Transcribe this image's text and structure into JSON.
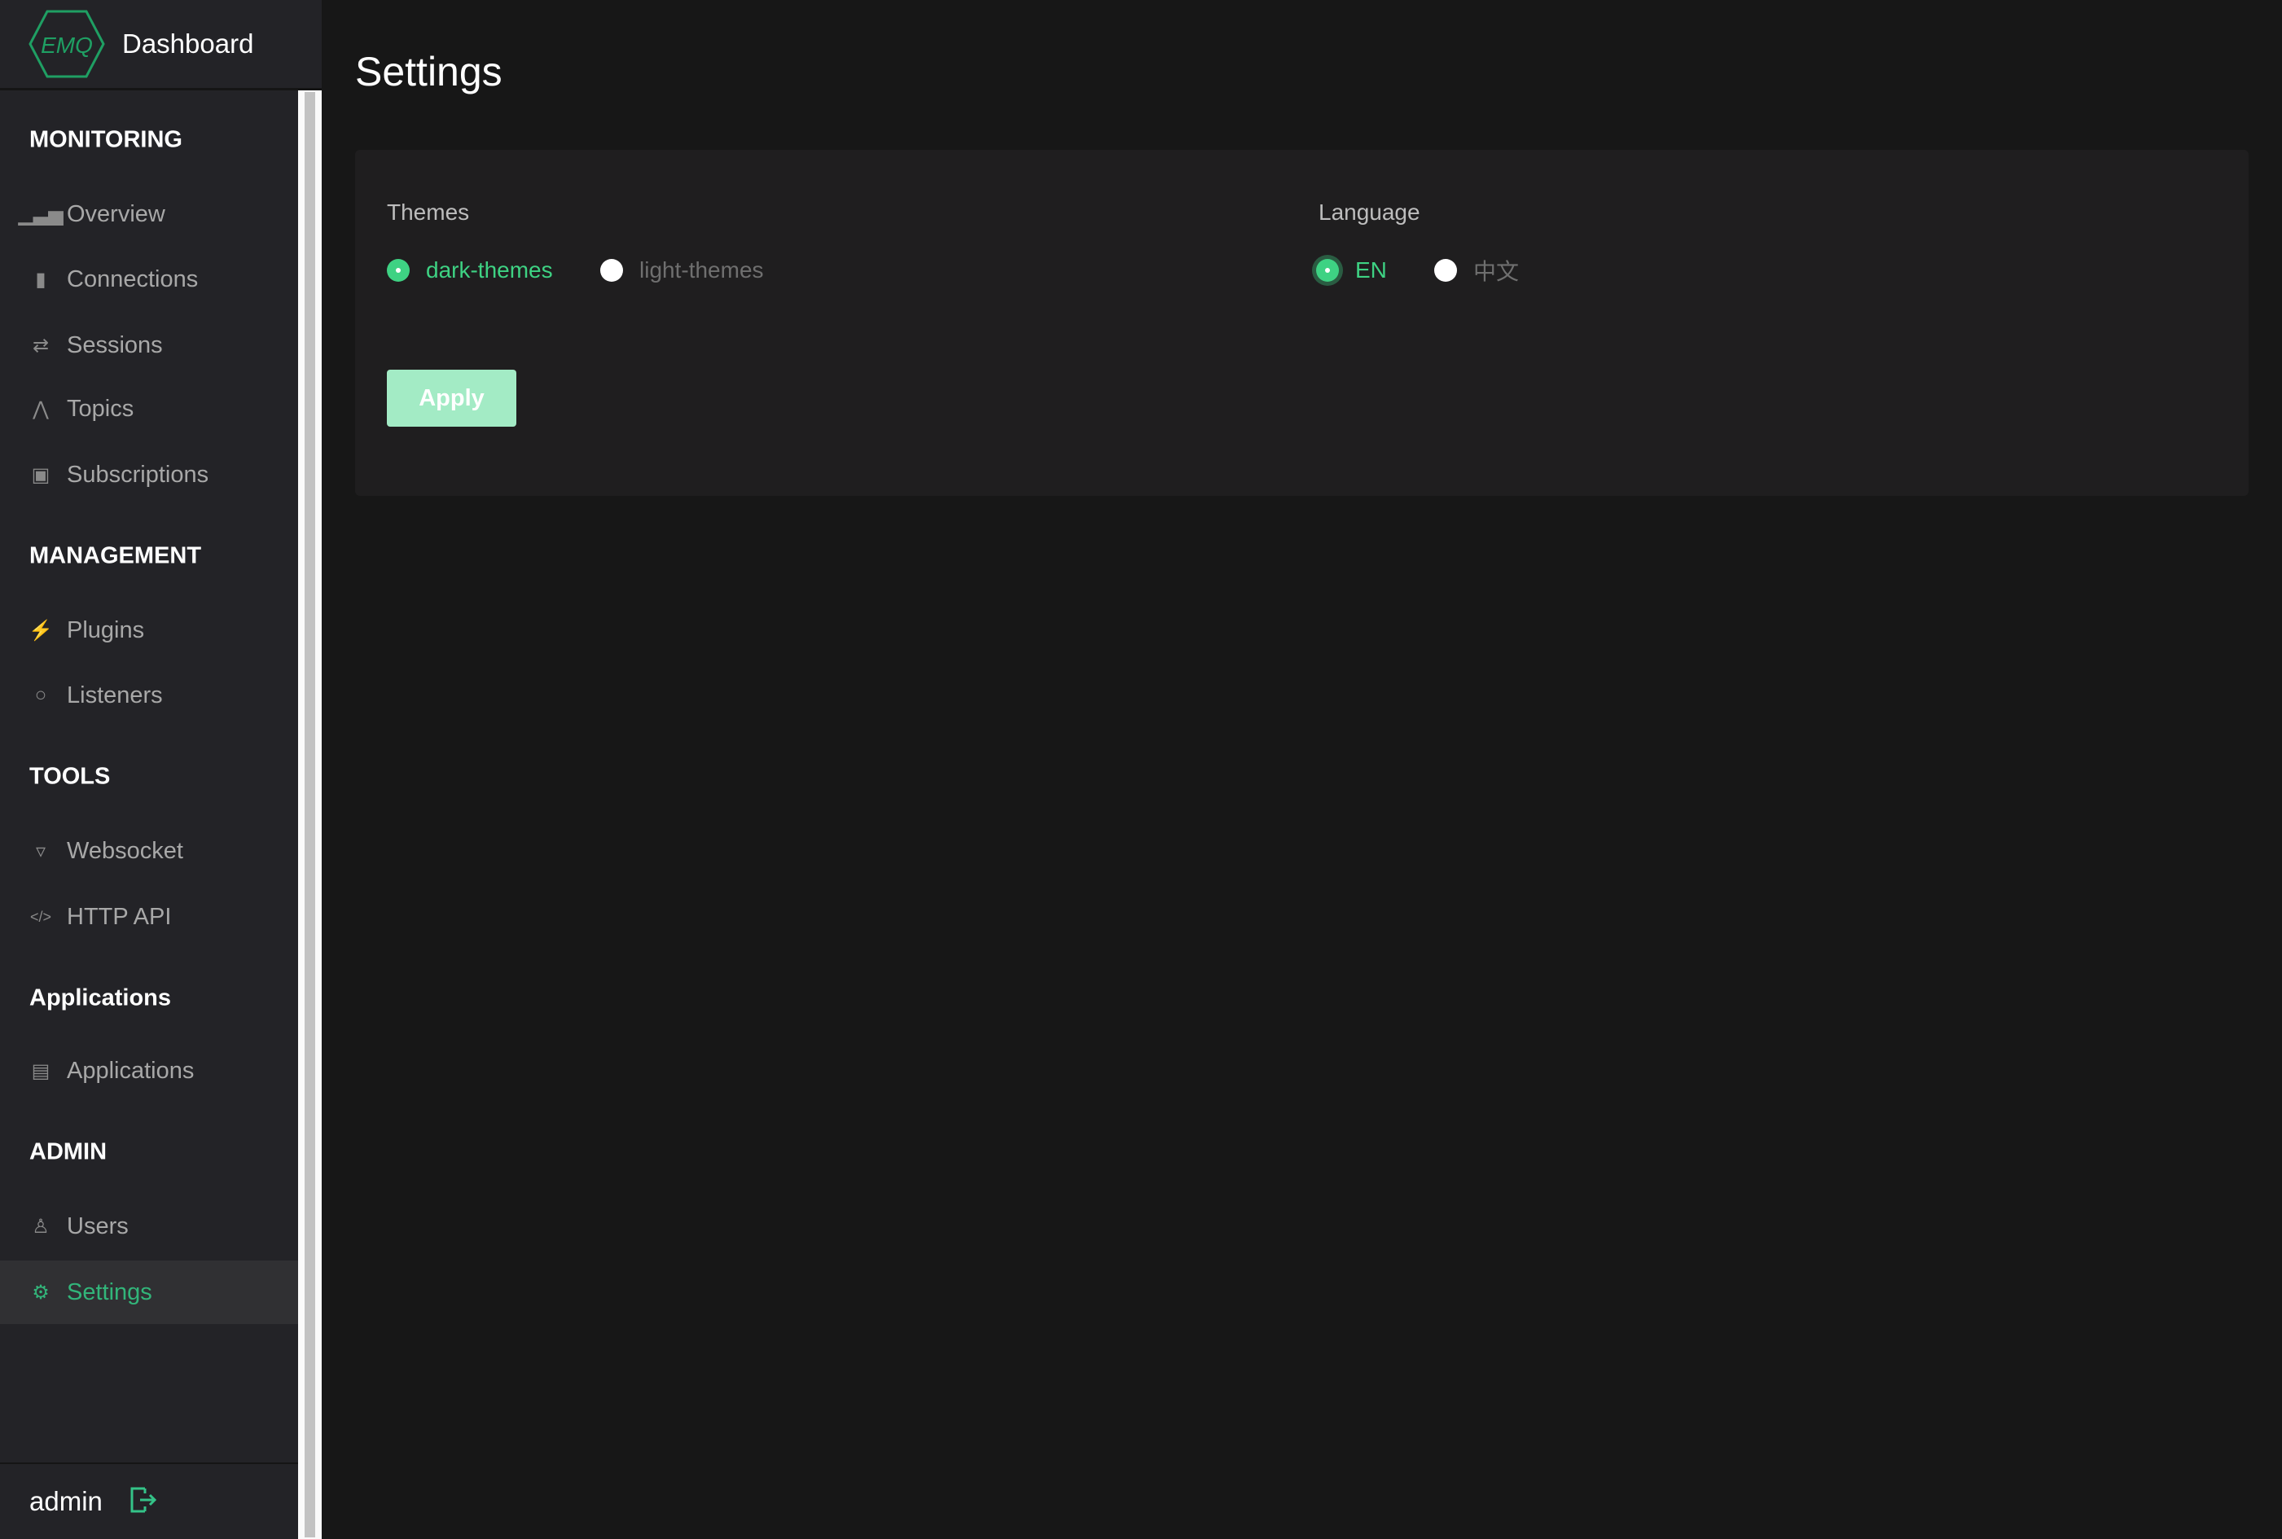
{
  "brand": {
    "logo_text": "EMQ",
    "title": "Dashboard"
  },
  "sidebar": {
    "groups": [
      {
        "label": "MONITORING",
        "items": [
          {
            "label": "Overview",
            "icon": "bar-chart-icon"
          },
          {
            "label": "Connections",
            "icon": "chip-icon"
          },
          {
            "label": "Sessions",
            "icon": "swap-icon"
          },
          {
            "label": "Topics",
            "icon": "topic-icon"
          },
          {
            "label": "Subscriptions",
            "icon": "rss-icon"
          }
        ]
      },
      {
        "label": "MANAGEMENT",
        "items": [
          {
            "label": "Plugins",
            "icon": "plug-icon"
          },
          {
            "label": "Listeners",
            "icon": "listener-icon"
          }
        ]
      },
      {
        "label": "TOOLS",
        "items": [
          {
            "label": "Websocket",
            "icon": "html5-icon"
          },
          {
            "label": "HTTP API",
            "icon": "code-icon"
          }
        ]
      },
      {
        "label": "Applications",
        "items": [
          {
            "label": "Applications",
            "icon": "archive-icon"
          }
        ]
      },
      {
        "label": "ADMIN",
        "items": [
          {
            "label": "Users",
            "icon": "user-icon"
          },
          {
            "label": "Settings",
            "icon": "gear-icon",
            "active": true
          }
        ]
      }
    ],
    "user": "admin"
  },
  "page": {
    "title": "Settings"
  },
  "settings": {
    "themes_label": "Themes",
    "themes": [
      {
        "label": "dark-themes",
        "selected": true
      },
      {
        "label": "light-themes",
        "selected": false
      }
    ],
    "language_label": "Language",
    "languages": [
      {
        "label": "EN",
        "selected": true
      },
      {
        "label": "中文",
        "selected": false
      }
    ],
    "apply_label": "Apply"
  },
  "colors": {
    "accent": "#3ed283",
    "sidebar": "#232327",
    "background": "#171717",
    "card": "#1f1e1f"
  }
}
